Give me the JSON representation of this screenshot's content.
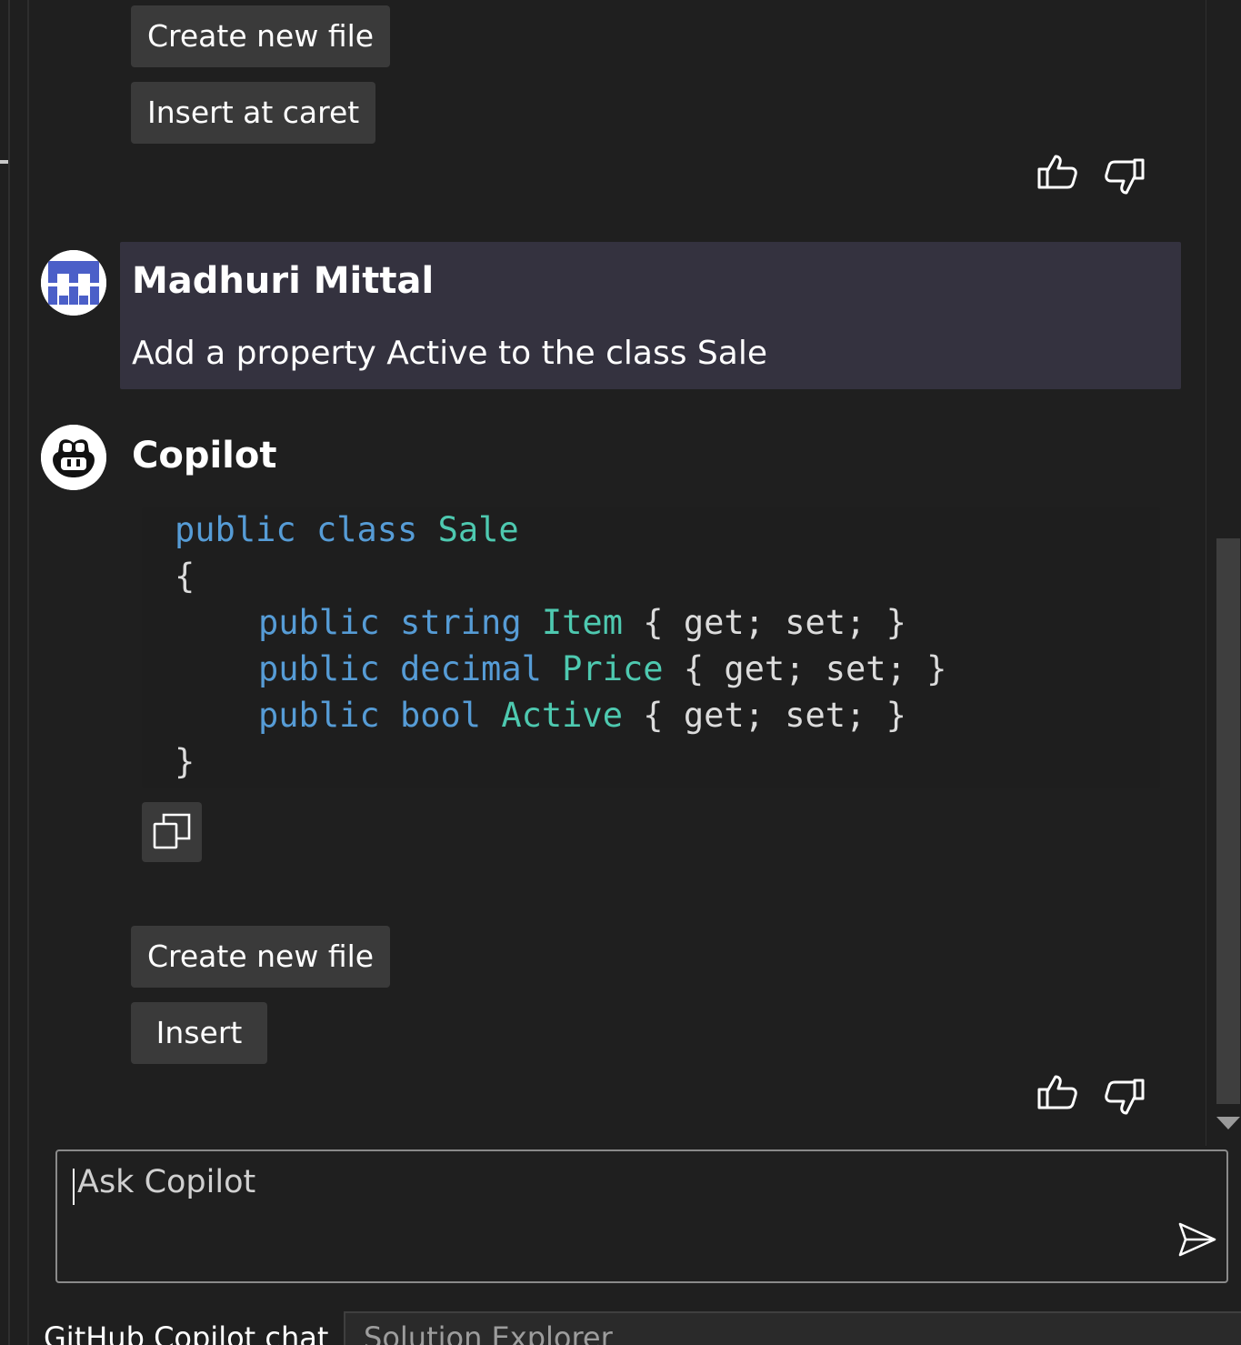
{
  "top_actions": {
    "create_new_file": "Create new file",
    "insert_at_caret": "Insert at caret"
  },
  "user_message": {
    "author": "Madhuri Mittal",
    "text": "Add a property Active to the class Sale"
  },
  "copilot_message": {
    "author": "Copilot",
    "code": {
      "line1": {
        "kw1": "public",
        "kw2": "class",
        "type": "Sale"
      },
      "open_brace": "{",
      "props": [
        {
          "access": "public",
          "type_kw": "string",
          "name": "Item",
          "accessors": "{ get; set; }"
        },
        {
          "access": "public",
          "type_kw": "decimal",
          "name": "Price",
          "accessors": "{ get; set; }"
        },
        {
          "access": "public",
          "type_kw": "bool",
          "name": "Active",
          "accessors": "{ get; set; }"
        }
      ],
      "close_brace": "}"
    },
    "create_new_file": "Create new file",
    "insert": "Insert"
  },
  "input": {
    "placeholder": "Ask Copilot"
  },
  "tabs": {
    "copilot_chat": "GitHub Copilot chat",
    "solution_explorer": "Solution Explorer"
  },
  "colors": {
    "keyword": "#569cd6",
    "type": "#4ec9b0",
    "user_bubble": "#34323f",
    "avatar_blue": "#4b5fc8"
  }
}
